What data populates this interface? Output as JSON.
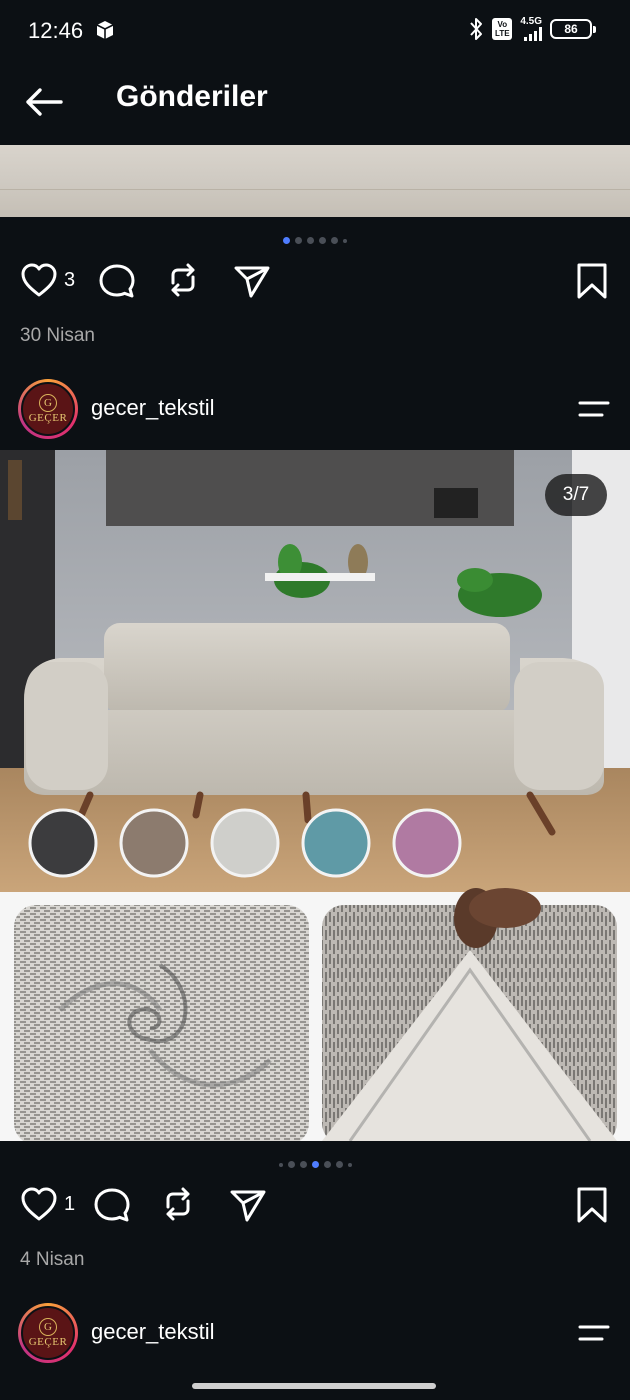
{
  "status_bar": {
    "time": "12:46",
    "volte_top": "Vo",
    "volte_bottom": "LTE",
    "network": "4.5G",
    "battery": "86"
  },
  "header": {
    "title": "Gönderiler"
  },
  "posts": [
    {
      "likes": "3",
      "date": "30 Nisan",
      "carousel_active": 1
    },
    {
      "username": "gecer_tekstil",
      "avatar_line1": "G",
      "avatar_line2": "GEÇER",
      "image_counter": "3/7",
      "likes": "1",
      "date": "4 Nisan",
      "carousel_active": 3,
      "swatch_colors": [
        "#3c3c3e",
        "#8c7b6e",
        "#cfcfcb",
        "#5f9aa6",
        "#b07aa2"
      ]
    },
    {
      "username": "gecer_tekstil",
      "avatar_line1": "G",
      "avatar_line2": "GEÇER"
    }
  ],
  "colors": {
    "background": "#0c1014",
    "accent": "#4f7dff",
    "muted_text": "#a8a8a8"
  },
  "icons": {
    "back": "arrow-left-icon",
    "like": "heart-icon",
    "comment": "comment-bubble-icon",
    "repost": "repost-icon",
    "share": "send-icon",
    "save": "bookmark-icon",
    "menu": "menu-icon"
  }
}
